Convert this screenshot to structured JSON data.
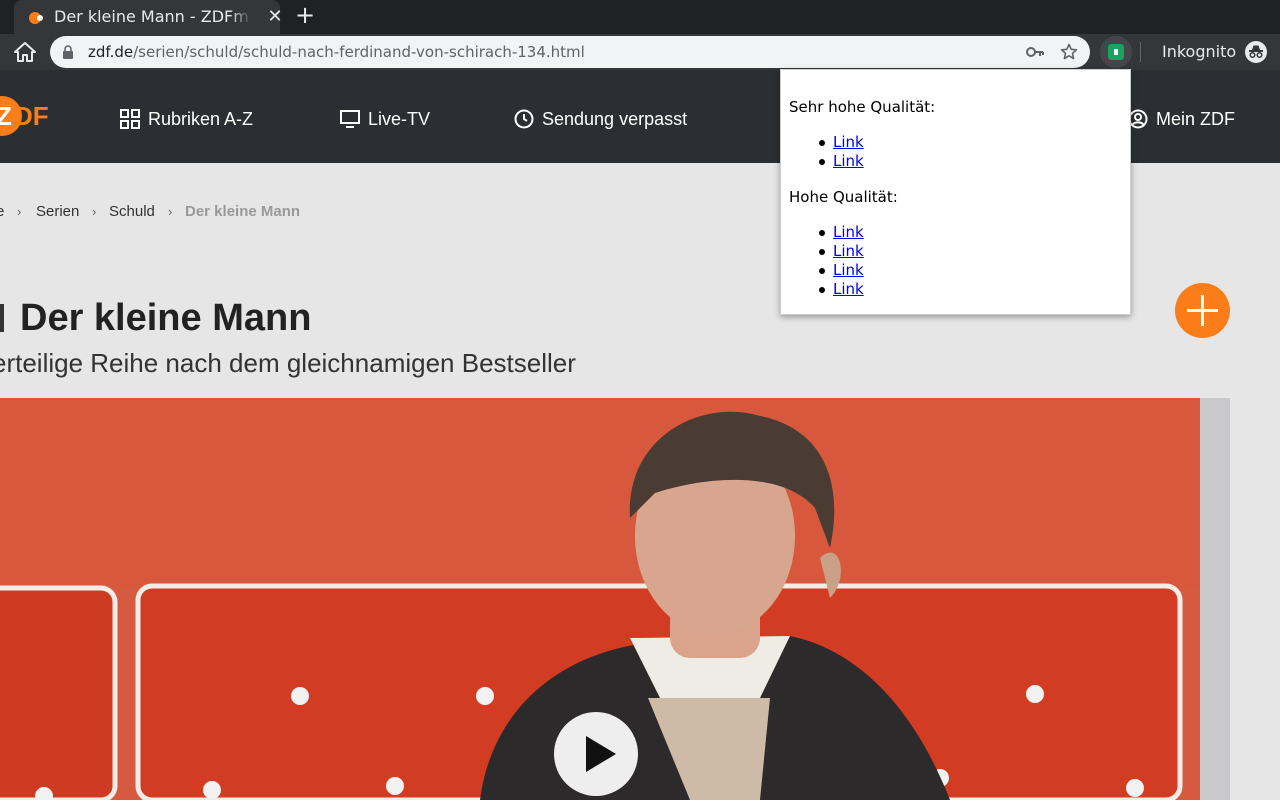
{
  "browser": {
    "tab_title": "Der kleine Mann - ZDFmediathek",
    "tab_close": "✕",
    "new_tab": "+",
    "url_host": "zdf.de",
    "url_path": "/serien/schuld/schuld-nach-ferdinand-von-schirach-134.html",
    "incognito_label": "Inkognito"
  },
  "site_nav": {
    "items": [
      {
        "label": "Rubriken A-Z",
        "icon": "grid-icon"
      },
      {
        "label": "Live-TV",
        "icon": "tv-icon"
      },
      {
        "label": "Sendung verpasst",
        "icon": "clock-icon"
      },
      {
        "label": "Mein ZDF",
        "icon": "user-circle-icon"
      }
    ]
  },
  "breadcrumb": {
    "items": [
      "e",
      "Serien",
      "Schuld",
      "Der kleine Mann"
    ],
    "separator": "›"
  },
  "page": {
    "title": "Der kleine Mann",
    "subtitle": "erteilige Reihe nach dem gleichnamigen Bestseller"
  },
  "popup": {
    "sections": [
      {
        "heading": "Sehr hohe Qualität:",
        "links": [
          "Link",
          "Link"
        ]
      },
      {
        "heading": "Hohe Qualität:",
        "links": [
          "Link",
          "Link",
          "Link",
          "Link"
        ]
      }
    ]
  },
  "colors": {
    "zdf_orange": "#fa7d19",
    "header_bg": "#2b2f33",
    "page_bg": "#e6e6e6"
  }
}
